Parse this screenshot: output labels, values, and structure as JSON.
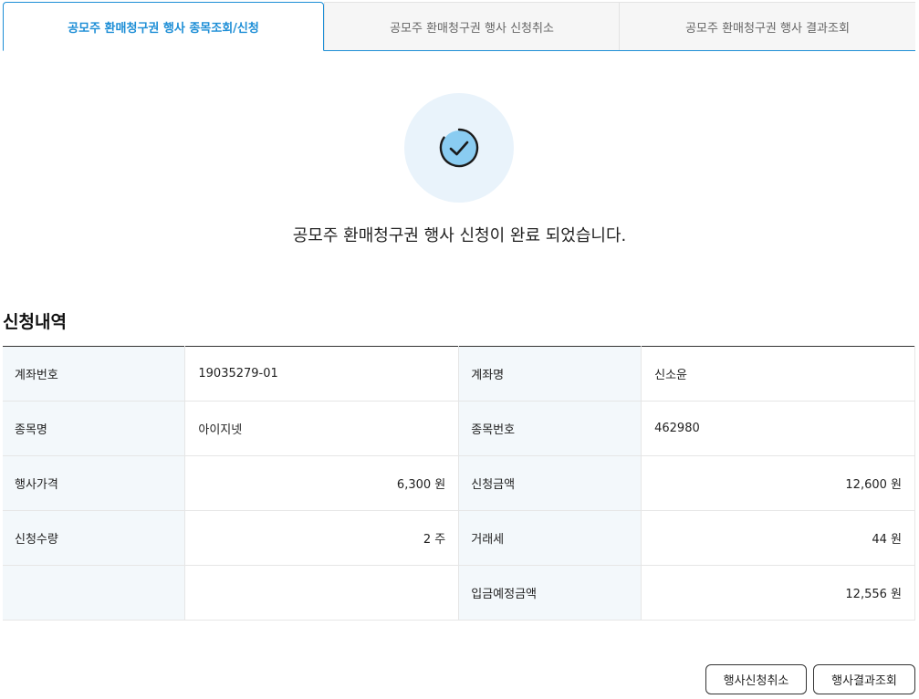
{
  "tabs": [
    {
      "label": "공모주 환매청구권 행사 종목조회/신청",
      "active": true
    },
    {
      "label": "공모주 환매청구권 행사 신청취소",
      "active": false
    },
    {
      "label": "공모주 환매청구권 행사 결과조회",
      "active": false
    }
  ],
  "completion": {
    "icon": "check-circle-icon",
    "message": "공모주 환매청구권 행사 신청이 완료 되었습니다."
  },
  "section_title": "신청내역",
  "details": {
    "account_no_label": "계좌번호",
    "account_no": "19035279-01",
    "account_name_label": "계좌명",
    "account_name": "신소윤",
    "stock_name_label": "종목명",
    "stock_name": "아이지넷",
    "stock_code_label": "종목번호",
    "stock_code": "462980",
    "exercise_price_label": "행사가격",
    "exercise_price": "6,300 원",
    "apply_amount_label": "신청금액",
    "apply_amount": "12,600 원",
    "apply_qty_label": "신청수량",
    "apply_qty": "2 주",
    "tax_label": "거래세",
    "tax": "44 원",
    "deposit_label": "입금예정금액",
    "deposit": "12,556 원"
  },
  "buttons": {
    "cancel_apply": "행사신청취소",
    "result_inquiry": "행사결과조회"
  },
  "colors": {
    "accent": "#1d8ed6",
    "header_cell_bg": "#f3f8fb",
    "icon_bg": "#e9f3fb",
    "icon_fill": "#7fc8f0"
  }
}
